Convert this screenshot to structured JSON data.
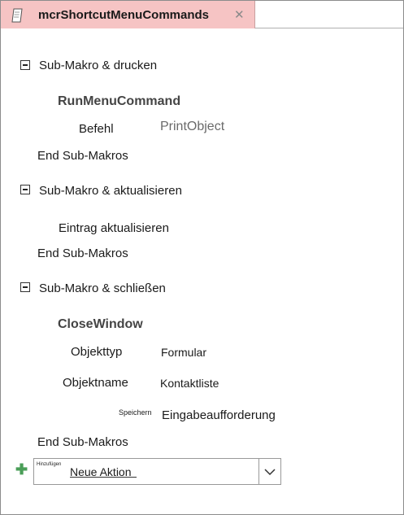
{
  "tab": {
    "title": "mcrShortcutMenuCommands",
    "close_glyph": "✕"
  },
  "blocks": [
    {
      "header": "Sub-Makro & drucken",
      "end": "End Sub-Makros"
    },
    {
      "header": "Sub-Makro & aktualisieren",
      "end": "End Sub-Makros"
    },
    {
      "header": "Sub-Makro & schließen",
      "end": "End Sub-Makros"
    }
  ],
  "block1": {
    "command": "RunMenuCommand",
    "arg_label": "Befehl",
    "arg_value": "PrintObject"
  },
  "block2": {
    "action": "Eintrag aktualisieren"
  },
  "block3": {
    "command": "CloseWindow",
    "args": [
      {
        "label": "Objekttyp",
        "value": "Formular"
      },
      {
        "label": "Objektname",
        "value": "Kontaktliste"
      },
      {
        "label": "Speichern",
        "value": "Eingabeaufforderung"
      }
    ]
  },
  "add_action": {
    "small_label": "Hinzufügen",
    "value": "Neue Aktion"
  },
  "icons": {
    "add": "plus-icon",
    "dropdown": "chevron-down-icon",
    "document": "macro-document-icon"
  },
  "colors": {
    "tab_bg": "#f6c4c4",
    "plus": "#4a9e58"
  }
}
